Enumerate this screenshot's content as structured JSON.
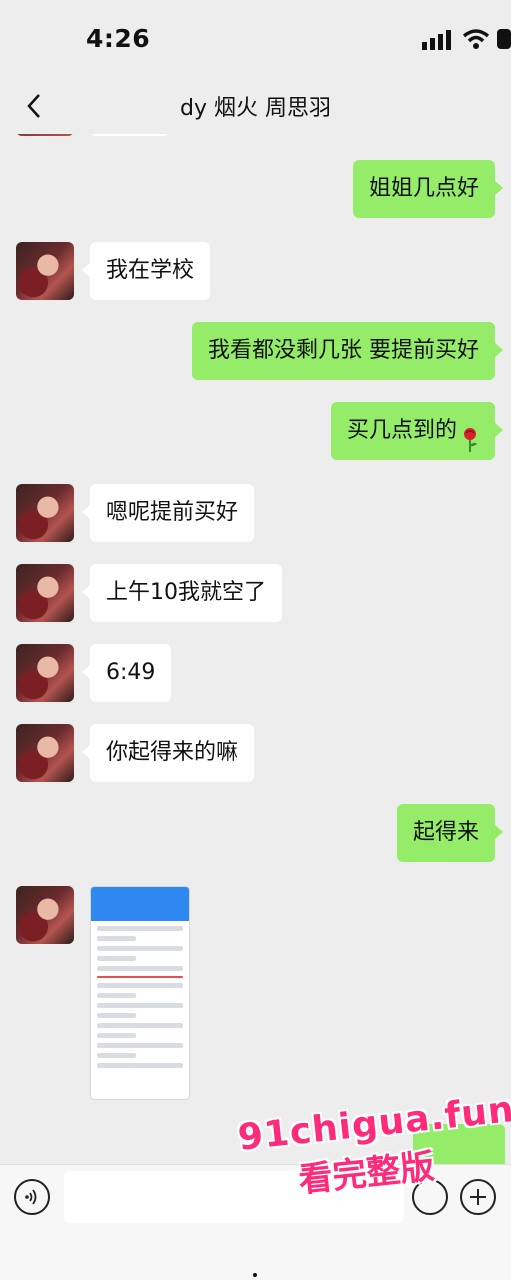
{
  "status_bar": {
    "time": "4:26"
  },
  "nav": {
    "title": "dy 烟火 周思羽"
  },
  "messages": [
    {
      "side": "out",
      "text": "姐姐几点好"
    },
    {
      "side": "in",
      "text": "我在学校"
    },
    {
      "side": "out",
      "text": "我看都没剩几张 要提前买好"
    },
    {
      "side": "out",
      "text": "买几点到的",
      "emoji": "rose-icon"
    },
    {
      "side": "in",
      "text": "嗯呢提前买好"
    },
    {
      "side": "in",
      "text": "上午10我就空了"
    },
    {
      "side": "in",
      "text": "6:49"
    },
    {
      "side": "in",
      "text": "你起得来的嘛"
    },
    {
      "side": "out",
      "text": "起得来"
    },
    {
      "side": "in",
      "type": "image",
      "icon": "ticket-screenshot"
    }
  ],
  "input": {
    "value": "",
    "placeholder": ""
  },
  "watermark": {
    "line1": "91chigua.fun",
    "line2": "看完整版"
  },
  "colors": {
    "out_bubble": "#95ec69",
    "in_bubble": "#ffffff",
    "background": "#ededed",
    "watermark": "#ff2b7a"
  }
}
